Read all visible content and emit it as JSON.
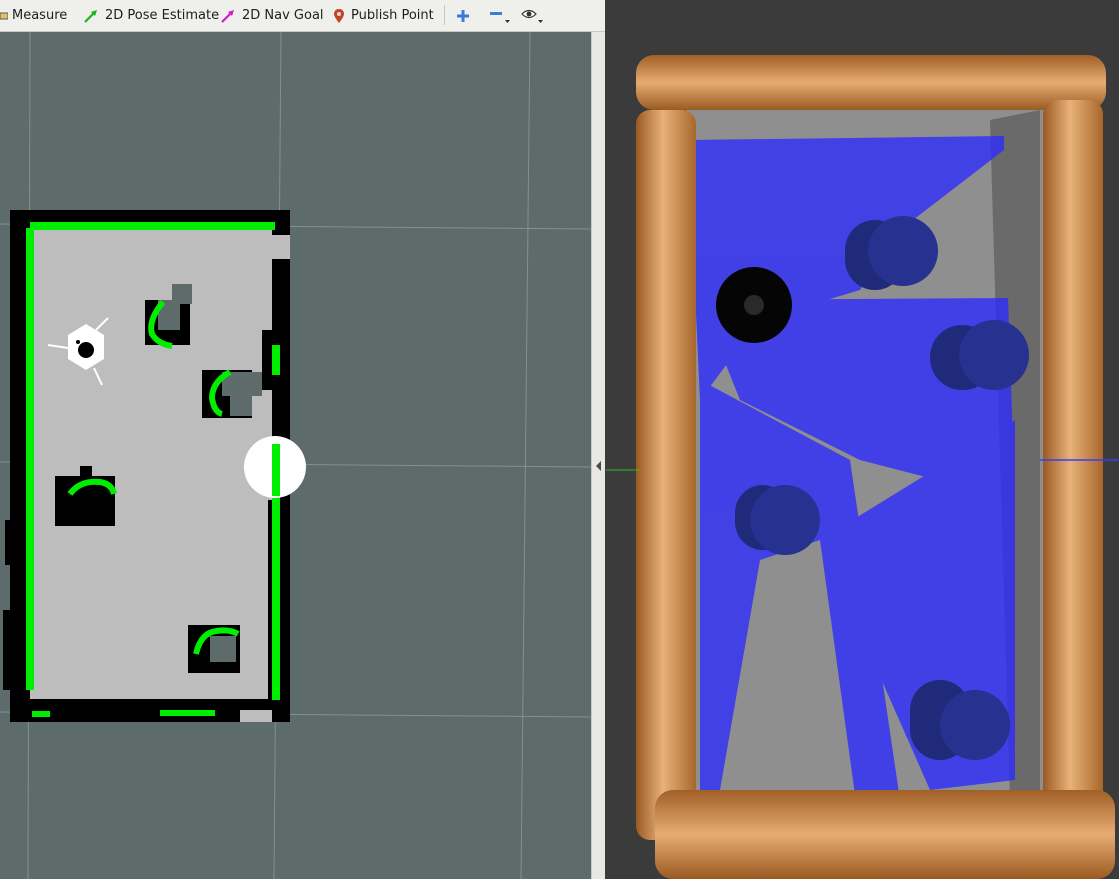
{
  "toolbar": {
    "measure_label": "Measure",
    "pose_estimate_label": "2D Pose Estimate",
    "nav_goal_label": "2D Nav Goal",
    "publish_point_label": "Publish Point"
  },
  "icons": {
    "measure": "ruler-icon",
    "pose_estimate": "green-arrow-icon",
    "nav_goal": "magenta-arrow-icon",
    "publish_point": "map-pin-icon",
    "zoom_in": "plus-icon",
    "zoom_out": "minus-icon",
    "view": "eye-icon"
  },
  "colors": {
    "rviz_background": "#5d6b6b",
    "map_free": "#bdbdbd",
    "map_occupied": "#000000",
    "laser_points": "#00ee00",
    "gazebo_laser": "#2b2bff",
    "wood": "#c8853d"
  }
}
